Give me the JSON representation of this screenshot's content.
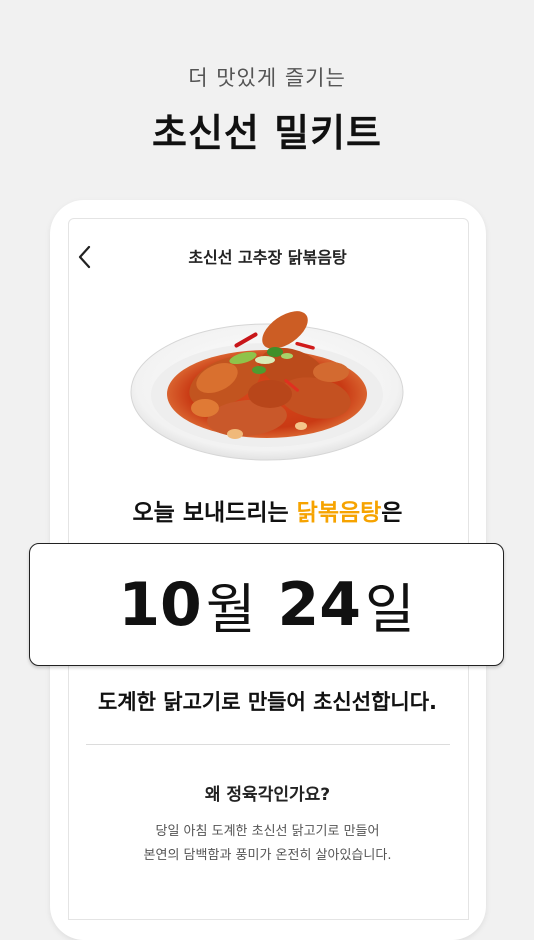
{
  "intro": {
    "eyebrow": "더 맛있게 즐기는",
    "headline": "초신선 밀키트"
  },
  "screen": {
    "title": "초신선 고추장 닭볶음탕",
    "back_icon": "chevron-left-icon",
    "dish_image": "dakbokkeumtang-plate"
  },
  "delivery": {
    "prefix": "오늘 보내드리는 ",
    "highlight": "닭볶음탕",
    "suffix": "은",
    "accent_color": "#f6a300",
    "month": "10",
    "month_unit": "월",
    "day": "24",
    "day_unit": "일"
  },
  "made_line": "도계한 닭고기로 만들어 초신선합니다.",
  "why": {
    "title": "왜 정육각인가요?",
    "lines": [
      "당일 아침 도계한 초신선 닭고기로 만들어",
      "본연의 담백함과 풍미가 온전히 살아있습니다."
    ]
  }
}
